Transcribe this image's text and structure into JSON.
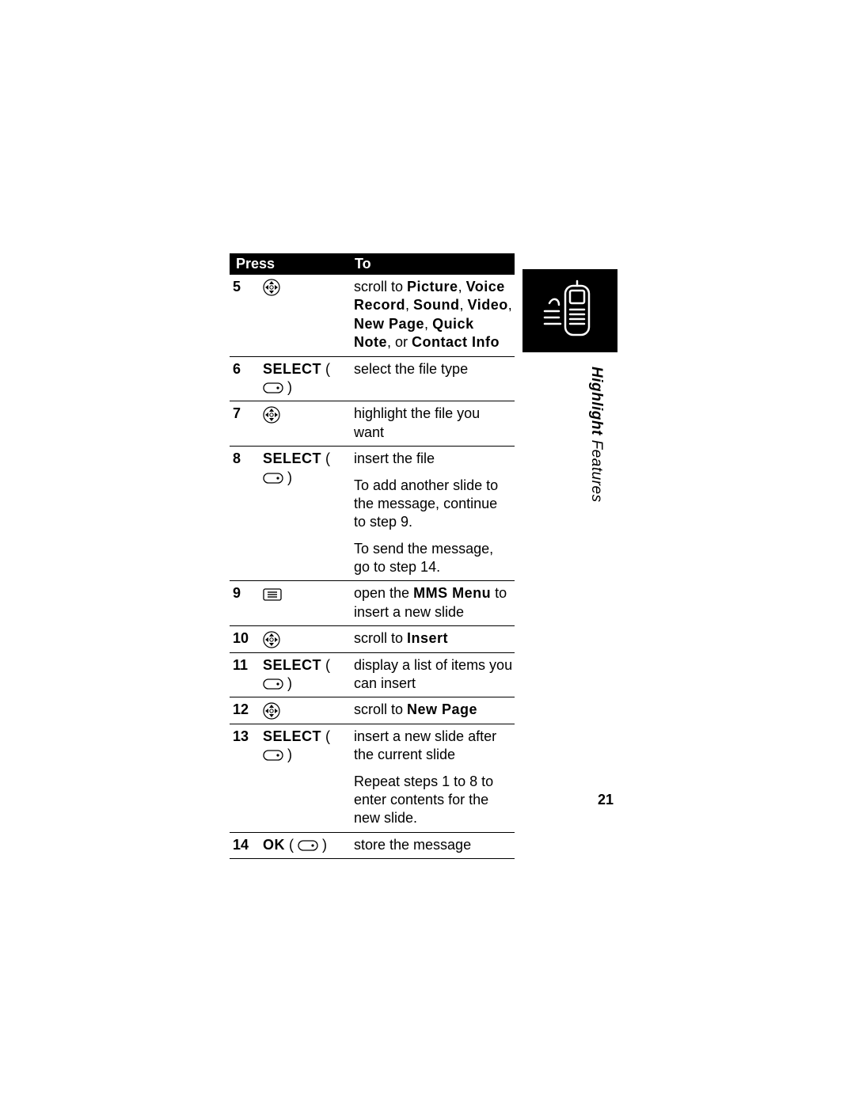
{
  "header": {
    "press": "Press",
    "to": "To"
  },
  "rows": {
    "r5": {
      "num": "5",
      "to_pre": "scroll to ",
      "b1": "Picture",
      "s1": ", ",
      "b2": "Voice Record",
      "s2": ", ",
      "b3": "Sound",
      "s3": ", ",
      "b4": "Video",
      "s4": ", ",
      "b5": "New Page",
      "s5": ", ",
      "b6": "Quick Note",
      "s6": ", or ",
      "b7": "Contact Info"
    },
    "r6": {
      "num": "6",
      "press": "SELECT",
      "to": "select the file type"
    },
    "r7": {
      "num": "7",
      "to": "highlight the file you want"
    },
    "r8": {
      "num": "8",
      "press": "SELECT",
      "to1": "insert the file",
      "to2": "To add another slide to the message, continue to step 9.",
      "to3": "To send the message, go to step 14."
    },
    "r9": {
      "num": "9",
      "to_pre": "open the ",
      "to_bold": "MMS Menu",
      "to_post": " to insert a new slide"
    },
    "r10": {
      "num": "10",
      "to_pre": "scroll to ",
      "to_bold": "Insert"
    },
    "r11": {
      "num": "11",
      "press": "SELECT",
      "to": "display a list of items you can insert"
    },
    "r12": {
      "num": "12",
      "to_pre": "scroll to ",
      "to_bold": "New Page"
    },
    "r13": {
      "num": "13",
      "press": "SELECT",
      "to1": "insert a new slide after the current slide",
      "to2": "Repeat steps 1 to 8 to enter contents for the new slide."
    },
    "r14": {
      "num": "14",
      "press": "OK",
      "to": "store the message"
    }
  },
  "sidetab": {
    "bold": "Highlight",
    "rest": " Features"
  },
  "page_number": "21"
}
